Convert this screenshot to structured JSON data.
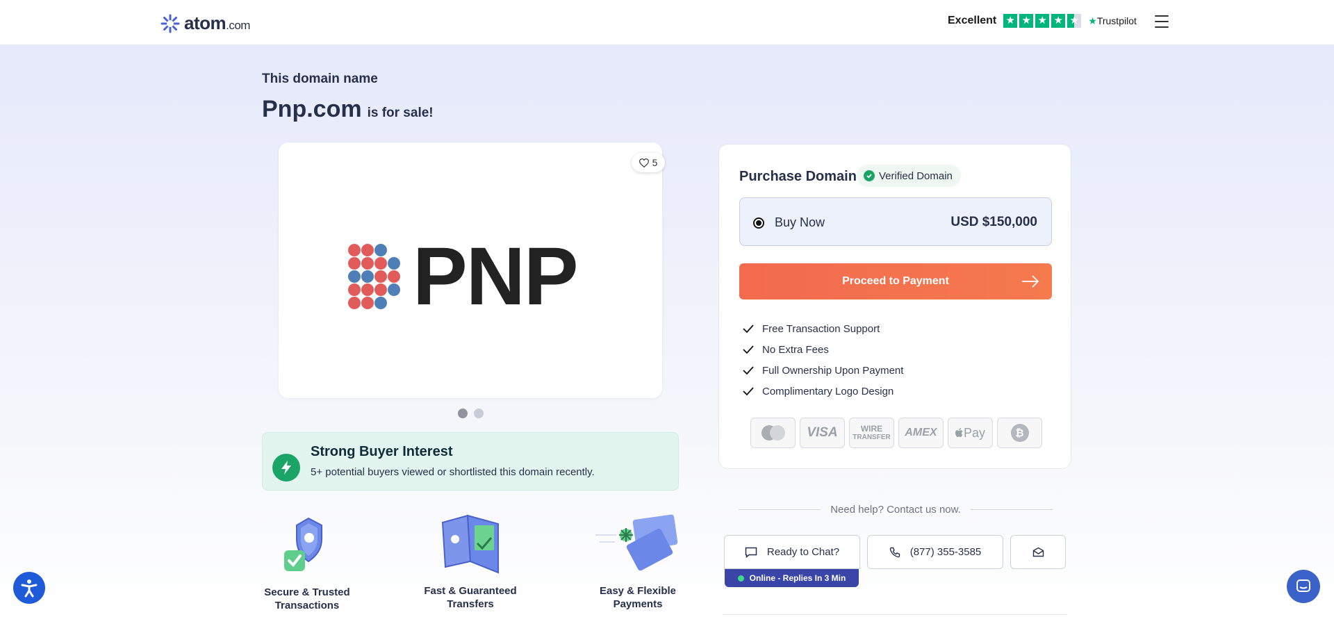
{
  "header": {
    "logo_text": "atom",
    "logo_suffix": ".com",
    "rating_label": "Excellent",
    "stars": 4.5,
    "trustpilot_label": "Trustpilot",
    "trustpilot_star": "★",
    "star_glyph": "★",
    "menu_icon": "hamburger-menu-icon"
  },
  "hero": {
    "subtitle": "This domain name",
    "domain": "Pnp.com",
    "for_sale": "is for sale!"
  },
  "logo_card": {
    "likes": "5",
    "logo_text": "PNP",
    "logo_colors": {
      "red": "#e25b5b",
      "blue": "#4e7fb6"
    },
    "slides": 2,
    "active_slide": 1
  },
  "interest": {
    "title": "Strong Buyer Interest",
    "text": "5+ potential buyers viewed or shortlisted this domain recently."
  },
  "features": [
    {
      "label_line1": "Secure & Trusted",
      "label_line2": "Transactions"
    },
    {
      "label_line1": "Fast & Guaranteed",
      "label_line2": "Transfers"
    },
    {
      "label_line1": "Easy & Flexible",
      "label_line2": "Payments"
    }
  ],
  "purchase": {
    "title": "Purchase Domain",
    "verified_label": "Verified Domain",
    "option_label": "Buy Now",
    "price": "USD $150,000",
    "proceed_label": "Proceed to Payment",
    "benefits": [
      "Free Transaction Support",
      "No Extra Fees",
      "Full Ownership Upon Payment",
      "Complimentary Logo Design"
    ],
    "payment_methods": [
      "mastercard-icon",
      "visa-icon",
      "wire-transfer-icon",
      "amex-icon",
      "apple-pay-icon",
      "bitcoin-icon"
    ],
    "visa_label": "VISA",
    "wire_label_1": "WIRE",
    "wire_label_2": "TRANSFER",
    "amex_label": "AMEX",
    "applepay_label": "Pay",
    "bitcoin_label": "₿"
  },
  "help": {
    "text": "Need help? Contact us now.",
    "chat_label": "Ready to Chat?",
    "phone_label": "(877) 355-3585",
    "online_status": "Online - Replies In 3 Min"
  },
  "colors": {
    "accent_orange": "#f26a4f",
    "brand_navy": "#3a45a8",
    "success_green": "#1aa566",
    "trustpilot_green": "#00b67a"
  }
}
